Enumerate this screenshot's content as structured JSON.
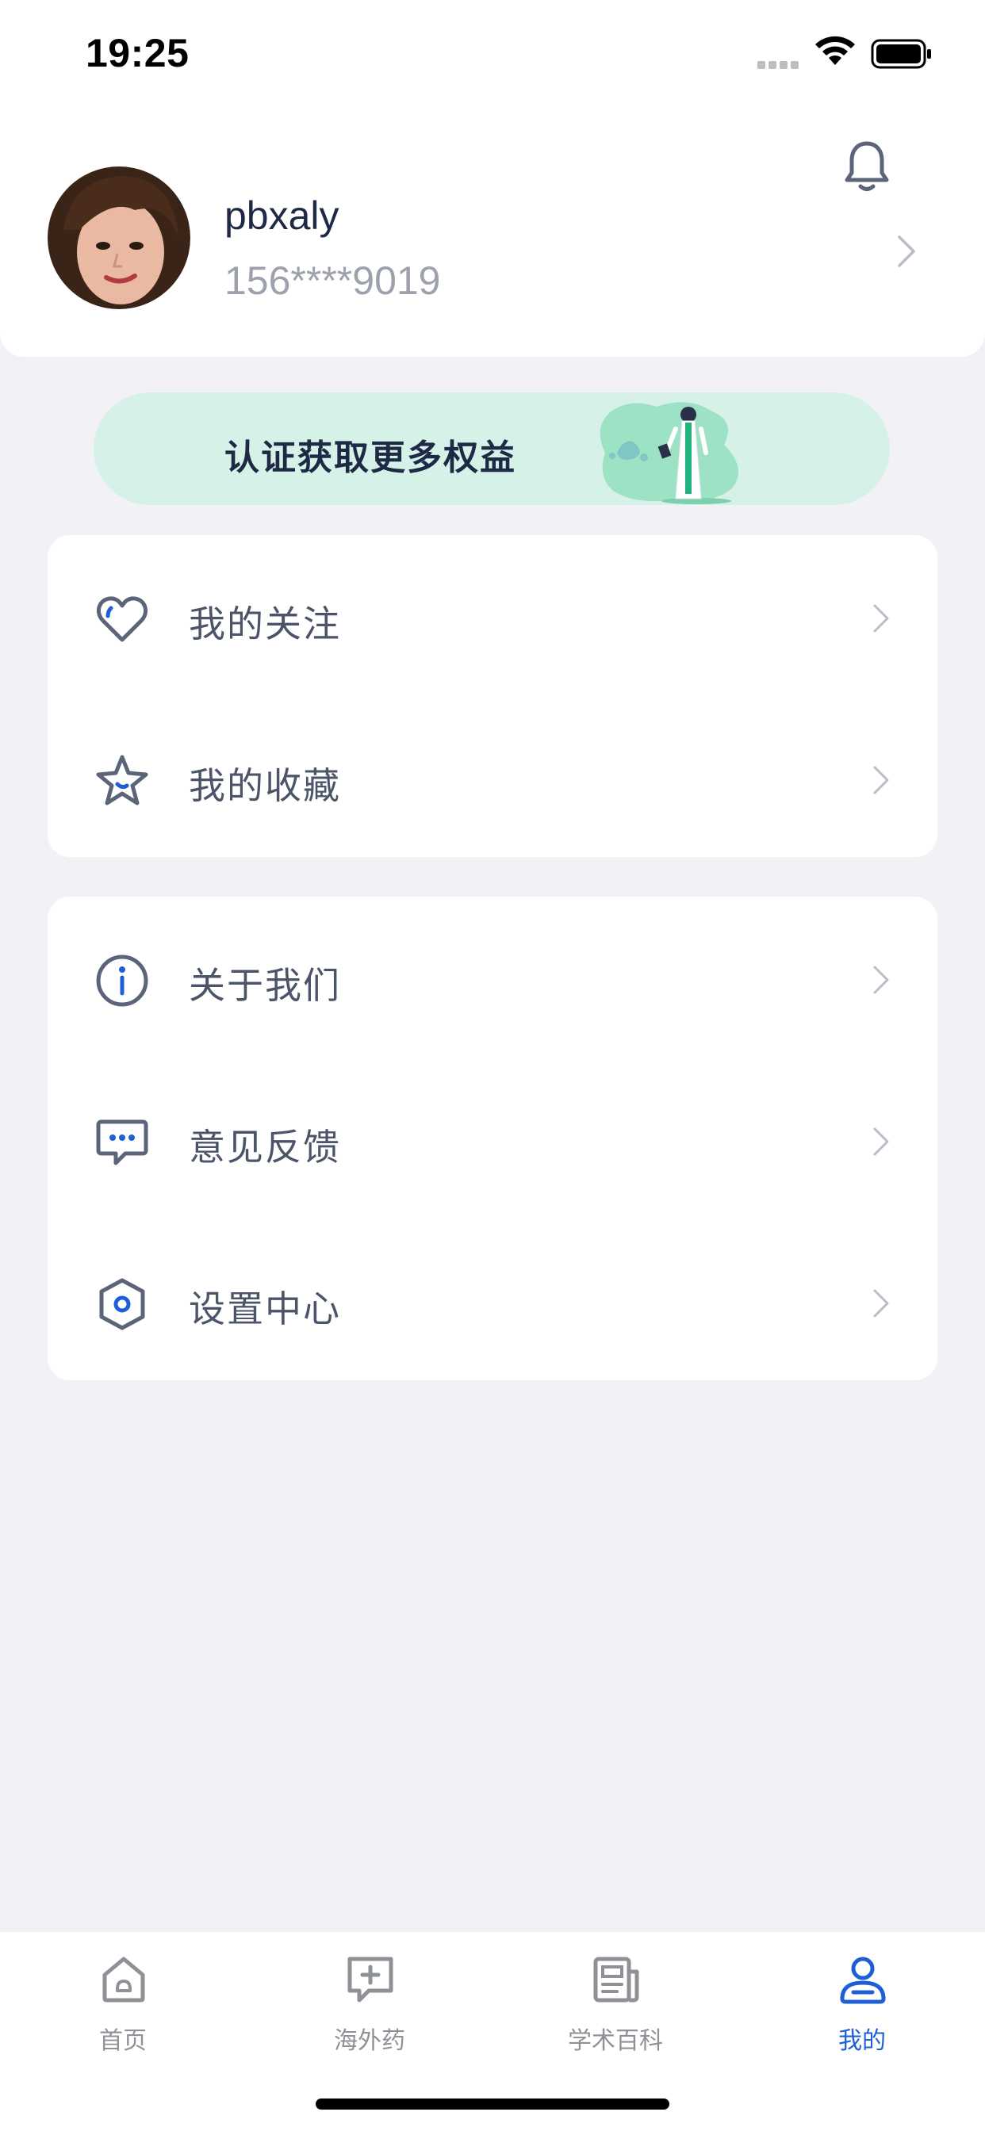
{
  "status_bar": {
    "time": "19:25"
  },
  "profile": {
    "username": "pbxaly",
    "phone": "156****9019"
  },
  "banner": {
    "text": "认证获取更多权益"
  },
  "menu_group_1": [
    {
      "label": "我的关注",
      "icon": "heart-icon"
    },
    {
      "label": "我的收藏",
      "icon": "star-icon"
    }
  ],
  "menu_group_2": [
    {
      "label": "关于我们",
      "icon": "info-icon"
    },
    {
      "label": "意见反馈",
      "icon": "feedback-icon"
    },
    {
      "label": "设置中心",
      "icon": "settings-icon"
    }
  ],
  "tabbar": [
    {
      "label": "首页",
      "icon": "home-icon",
      "active": false
    },
    {
      "label": "海外药",
      "icon": "medicine-plus-icon",
      "active": false
    },
    {
      "label": "学术百科",
      "icon": "encyclopedia-icon",
      "active": false
    },
    {
      "label": "我的",
      "icon": "profile-icon",
      "active": true
    }
  ],
  "colors": {
    "accent": "#1E5FD6",
    "icon_gray": "#5B6478",
    "banner_bg": "#D6F1E7",
    "page_bg": "#F1F1F6"
  }
}
